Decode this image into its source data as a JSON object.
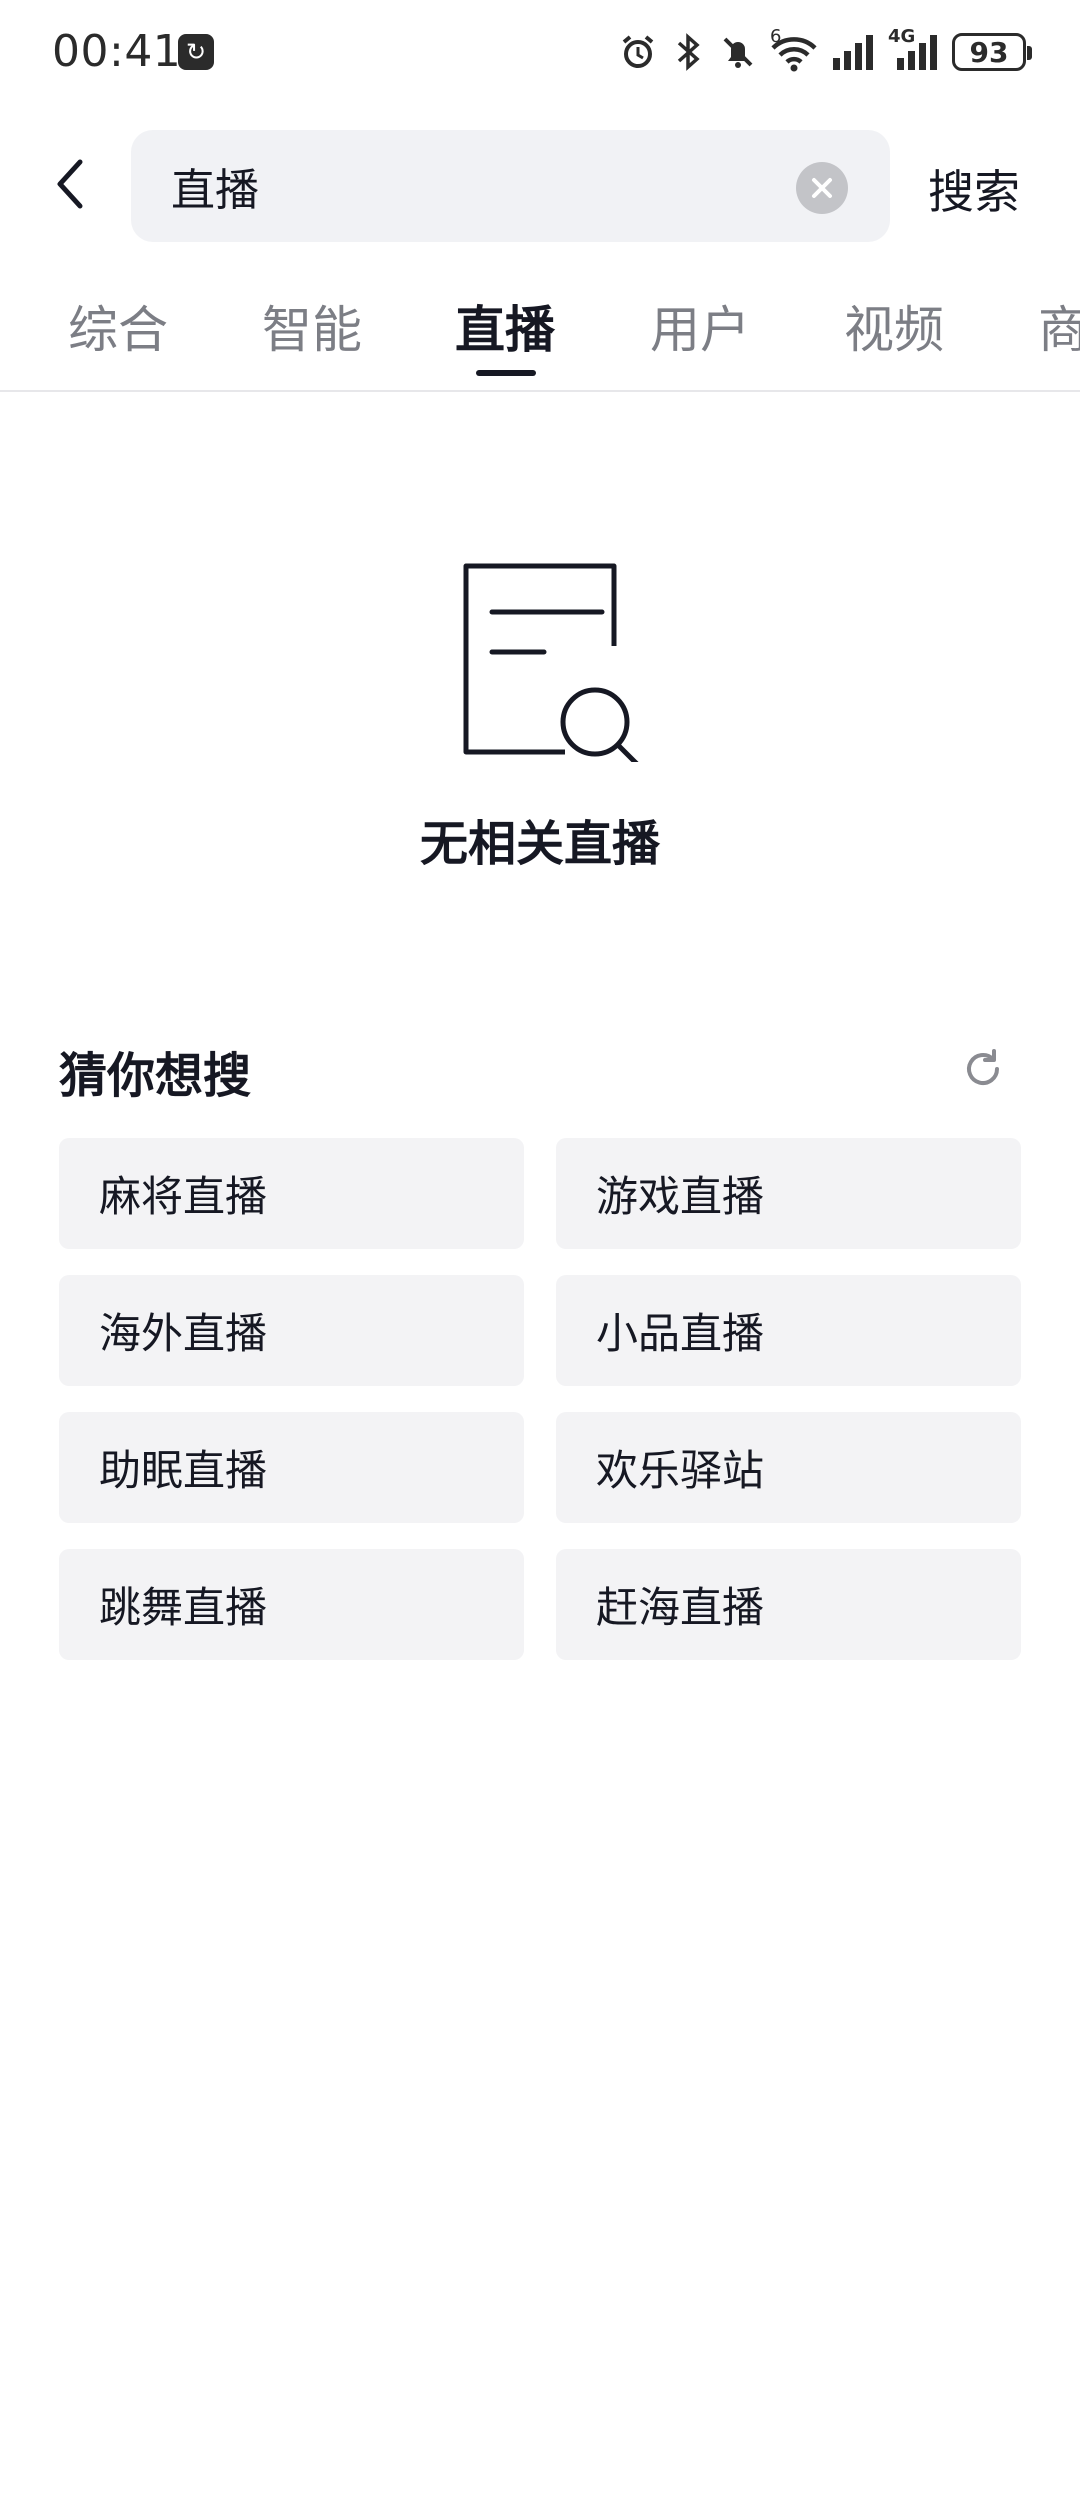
{
  "status_bar": {
    "time": "00:41",
    "app_icon": "sync-app-icon",
    "icons": [
      "alarm-icon",
      "bluetooth-icon",
      "mute-bell-icon",
      "wifi-6-icon",
      "signal-icon",
      "signal-4g-icon"
    ],
    "network_labels": {
      "wifi": "6",
      "cellular": "4G"
    },
    "battery_level": "93"
  },
  "header": {
    "back_icon": "chevron-left-icon",
    "search_value": "直播",
    "clear_icon": "close-icon",
    "submit_label": "搜索"
  },
  "tabs": [
    {
      "label": "综合",
      "active": false
    },
    {
      "label": "智能",
      "active": false
    },
    {
      "label": "直播",
      "active": true
    },
    {
      "label": "用户",
      "active": false
    },
    {
      "label": "视频",
      "active": false
    },
    {
      "label": "商",
      "active": false
    }
  ],
  "empty_state": {
    "icon": "document-search-icon",
    "message": "无相关直播"
  },
  "suggestions": {
    "title": "猜你想搜",
    "refresh_icon": "refresh-icon",
    "items": [
      "麻将直播",
      "游戏直播",
      "海外直播",
      "小品直播",
      "助眠直播",
      "欢乐驿站",
      "跳舞直播",
      "赶海直播"
    ]
  },
  "colors": {
    "text_primary": "#161823",
    "text_secondary": "#7c7e85",
    "search_bg": "#f1f2f5",
    "chip_bg": "#f3f3f5"
  }
}
